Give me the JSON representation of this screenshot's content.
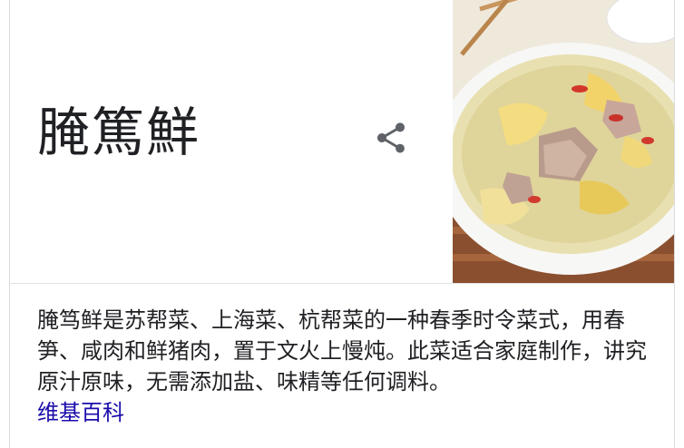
{
  "panel": {
    "title": "腌篤鮮",
    "share_icon": "share-icon",
    "image_subject": "bowl of yan du xian soup"
  },
  "description": {
    "text": "腌笃鲜是苏帮菜、上海菜、杭帮菜的一种春季时令菜式，用春笋、咸肉和鲜猪肉，置于文火上慢炖。此菜适合家庭制作，讲究原汁原味，无需添加盐、味精等任何调料。",
    "source_label": "维基百科"
  },
  "colors": {
    "title": "#202124",
    "link": "#1a0dab",
    "icon": "#5f6368"
  }
}
